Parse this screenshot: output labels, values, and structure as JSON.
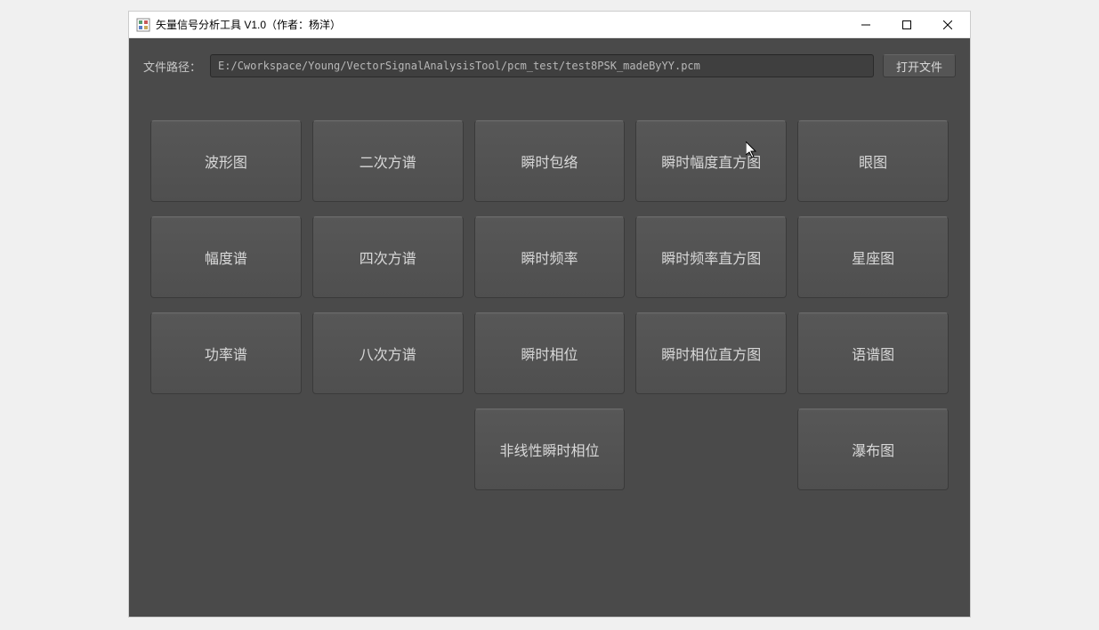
{
  "window": {
    "title": "矢量信号分析工具 V1.0（作者：杨洋）"
  },
  "file": {
    "label": "文件路径：",
    "path": "E:/Cworkspace/Young/VectorSignalAnalysisTool/pcm_test/test8PSK_madeByYY.pcm",
    "open_button": "打开文件"
  },
  "grid": {
    "row1": {
      "col1": "波形图",
      "col2": "二次方谱",
      "col3": "瞬时包络",
      "col4": "瞬时幅度直方图",
      "col5": "眼图"
    },
    "row2": {
      "col1": "幅度谱",
      "col2": "四次方谱",
      "col3": "瞬时频率",
      "col4": "瞬时频率直方图",
      "col5": "星座图"
    },
    "row3": {
      "col1": "功率谱",
      "col2": "八次方谱",
      "col3": "瞬时相位",
      "col4": "瞬时相位直方图",
      "col5": "语谱图"
    },
    "row4": {
      "col3": "非线性瞬时相位",
      "col5": "瀑布图"
    }
  }
}
